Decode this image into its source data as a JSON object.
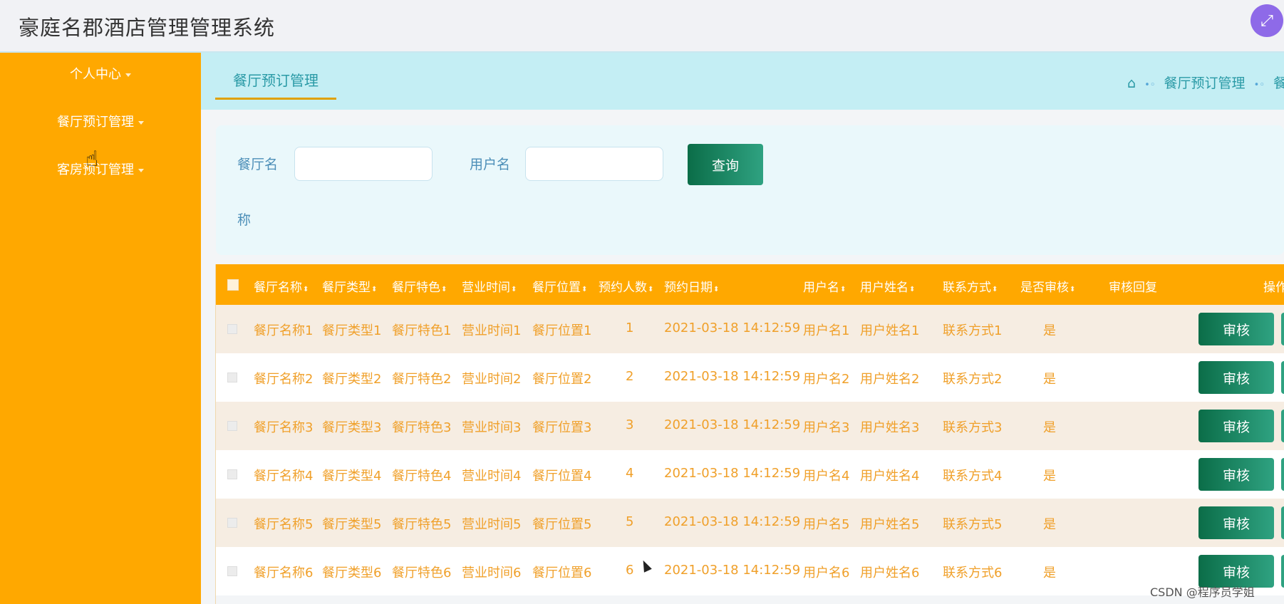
{
  "app_title": "豪庭名郡酒店管理管理系统",
  "fullscreen_icon": "⤢",
  "sidebar": {
    "items": [
      {
        "label": "个人中心"
      },
      {
        "label": "餐厅预订管理"
      },
      {
        "label": "客房预订管理"
      }
    ]
  },
  "tab": {
    "label": "餐厅预订管理"
  },
  "breadcrumb": {
    "home_icon": "⌂",
    "sep": "•◦",
    "item1": "餐厅预订管理",
    "item2": "餐"
  },
  "search": {
    "label1_line1": "餐厅名",
    "label1_line2": "称",
    "input1_value": "",
    "label2": "用户名",
    "input2_value": "",
    "query_label": "查询"
  },
  "table": {
    "headers": [
      "餐厅名称",
      "餐厅类型",
      "餐厅特色",
      "营业时间",
      "餐厅位置",
      "预约人数",
      "预约日期",
      "用户名",
      "用户姓名",
      "联系方式",
      "是否审核",
      "审核回复",
      "操作"
    ],
    "rows": [
      [
        "餐厅名称1",
        "餐厅类型1",
        "餐厅特色1",
        "营业时间1",
        "餐厅位置1",
        "1",
        "2021-03-18 14:12:59",
        "用户名1",
        "用户姓名1",
        "联系方式1",
        "是",
        ""
      ],
      [
        "餐厅名称2",
        "餐厅类型2",
        "餐厅特色2",
        "营业时间2",
        "餐厅位置2",
        "2",
        "2021-03-18 14:12:59",
        "用户名2",
        "用户姓名2",
        "联系方式2",
        "是",
        ""
      ],
      [
        "餐厅名称3",
        "餐厅类型3",
        "餐厅特色3",
        "营业时间3",
        "餐厅位置3",
        "3",
        "2021-03-18 14:12:59",
        "用户名3",
        "用户姓名3",
        "联系方式3",
        "是",
        ""
      ],
      [
        "餐厅名称4",
        "餐厅类型4",
        "餐厅特色4",
        "营业时间4",
        "餐厅位置4",
        "4",
        "2021-03-18 14:12:59",
        "用户名4",
        "用户姓名4",
        "联系方式4",
        "是",
        ""
      ],
      [
        "餐厅名称5",
        "餐厅类型5",
        "餐厅特色5",
        "营业时间5",
        "餐厅位置5",
        "5",
        "2021-03-18 14:12:59",
        "用户名5",
        "用户姓名5",
        "联系方式5",
        "是",
        ""
      ],
      [
        "餐厅名称6",
        "餐厅类型6",
        "餐厅特色6",
        "营业时间6",
        "餐厅位置6",
        "6",
        "2021-03-18 14:12:59",
        "用户名6",
        "用户姓名6",
        "联系方式6",
        "是",
        ""
      ]
    ],
    "audit_label": "审核"
  },
  "watermark": "CSDN @程序员学姐",
  "colors": {
    "sidebar": "#ffa800",
    "accent_green": "#0b6d48",
    "tab_bg": "#c4eef4"
  }
}
